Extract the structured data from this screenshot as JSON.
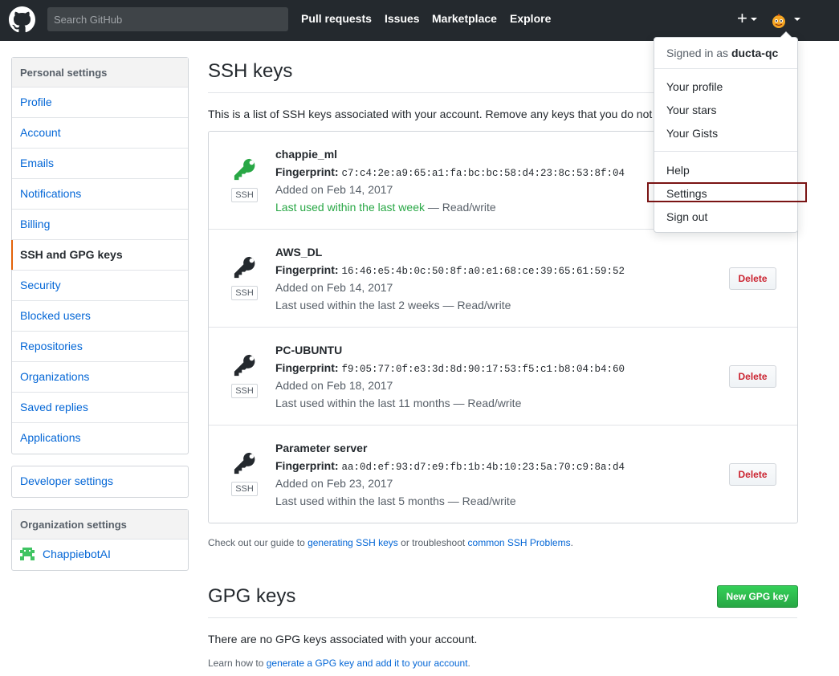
{
  "header": {
    "search_placeholder": "Search GitHub",
    "nav": [
      "Pull requests",
      "Issues",
      "Marketplace",
      "Explore"
    ],
    "new_icon": "plus-icon",
    "avatar_icon": "user-avatar"
  },
  "sidebar": {
    "personal_heading": "Personal settings",
    "items": [
      "Profile",
      "Account",
      "Emails",
      "Notifications",
      "Billing",
      "SSH and GPG keys",
      "Security",
      "Blocked users",
      "Repositories",
      "Organizations",
      "Saved replies",
      "Applications"
    ],
    "selected": "SSH and GPG keys",
    "developer": "Developer settings",
    "org_heading": "Organization settings",
    "org_item": "ChappiebotAI"
  },
  "ssh": {
    "title": "SSH keys",
    "description": "This is a list of SSH keys associated with your account. Remove any keys that you do not recognize.",
    "label": "SSH",
    "fingerprint_label": "Fingerprint:",
    "delete_label": "Delete",
    "keys": [
      {
        "name": "chappie_ml",
        "fingerprint": "c7:c4:2e:a9:65:a1:fa:bc:bc:58:d4:23:8c:53:8f:04",
        "added": "Added on Feb 14, 2017",
        "used": "Last used within the last week",
        "access": " — Read/write",
        "recent": true,
        "icon_color": "#28a745"
      },
      {
        "name": "AWS_DL",
        "fingerprint": "16:46:e5:4b:0c:50:8f:a0:e1:68:ce:39:65:61:59:52",
        "added": "Added on Feb 14, 2017",
        "used": "Last used within the last 2 weeks",
        "access": " — Read/write",
        "recent": false,
        "icon_color": "#24292e"
      },
      {
        "name": "PC-UBUNTU",
        "fingerprint": "f9:05:77:0f:e3:3d:8d:90:17:53:f5:c1:b8:04:b4:60",
        "added": "Added on Feb 18, 2017",
        "used": "Last used within the last 11 months",
        "access": " — Read/write",
        "recent": false,
        "icon_color": "#24292e"
      },
      {
        "name": "Parameter server",
        "fingerprint": "aa:0d:ef:93:d7:e9:fb:1b:4b:10:23:5a:70:c9:8a:d4",
        "added": "Added on Feb 23, 2017",
        "used": "Last used within the last 5 months",
        "access": " — Read/write",
        "recent": false,
        "icon_color": "#24292e"
      }
    ],
    "guide_prefix": "Check out our guide to ",
    "guide_link": "generating SSH keys",
    "guide_mid": " or troubleshoot ",
    "guide_link2": "common SSH Problems",
    "guide_suffix": "."
  },
  "gpg": {
    "title": "GPG keys",
    "new_button": "New GPG key",
    "empty": "There are no GPG keys associated with your account.",
    "learn_prefix": "Learn how to ",
    "learn_link": "generate a GPG key and add it to your account",
    "learn_suffix": "."
  },
  "dropdown": {
    "signed_in_prefix": "Signed in as ",
    "username": "ducta-qc",
    "group1": [
      "Your profile",
      "Your stars",
      "Your Gists"
    ],
    "group2": [
      "Help",
      "Settings",
      "Sign out"
    ]
  },
  "colors": {
    "header_bg": "#24292e",
    "link": "#0366d6",
    "success": "#28a745",
    "danger": "#cb2431",
    "selected_accent": "#e36209"
  }
}
